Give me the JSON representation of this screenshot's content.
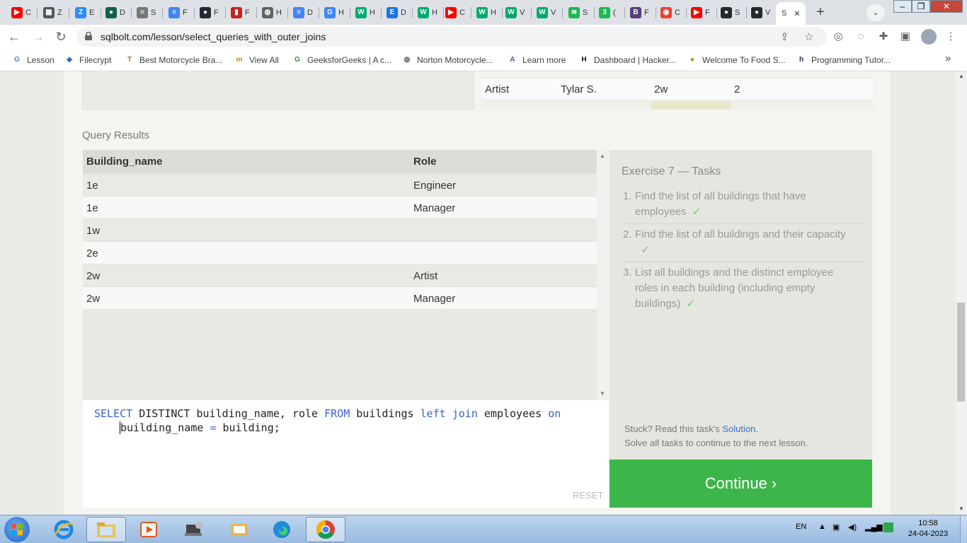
{
  "browser": {
    "tabs": [
      {
        "name": "tab-youtube-1",
        "letter": "C",
        "color": "#ff0000",
        "glyph": "▶"
      },
      {
        "name": "tab-2",
        "letter": "Z",
        "color": "#555555",
        "glyph": "▦"
      },
      {
        "name": "tab-zoom",
        "letter": "E",
        "color": "#2d8cff",
        "glyph": "Z"
      },
      {
        "name": "tab-mongodb",
        "letter": "D",
        "color": "#116149",
        "glyph": "●"
      },
      {
        "name": "tab-db",
        "letter": "S",
        "color": "#777777",
        "glyph": "≡"
      },
      {
        "name": "tab-docs-1",
        "letter": "F",
        "color": "#4285f4",
        "glyph": "≡"
      },
      {
        "name": "tab-github-1",
        "letter": "F",
        "color": "#24292e",
        "glyph": "●"
      },
      {
        "name": "tab-red",
        "letter": "F",
        "color": "#c5221f",
        "glyph": "▮"
      },
      {
        "name": "tab-globe",
        "letter": "H",
        "color": "#5f6368",
        "glyph": "◍"
      },
      {
        "name": "tab-docs-2",
        "letter": "D",
        "color": "#4285f4",
        "glyph": "≡"
      },
      {
        "name": "tab-google",
        "letter": "H",
        "color": "#4285f4",
        "glyph": "G"
      },
      {
        "name": "tab-w3-1",
        "letter": "H",
        "color": "#04aa6d",
        "glyph": "W"
      },
      {
        "name": "tab-ed",
        "letter": "D",
        "color": "#1a73e8",
        "glyph": "E"
      },
      {
        "name": "tab-w3-2",
        "letter": "H",
        "color": "#04aa6d",
        "glyph": "W"
      },
      {
        "name": "tab-youtube-2",
        "letter": "C",
        "color": "#ff0000",
        "glyph": "▶"
      },
      {
        "name": "tab-w3-3",
        "letter": "H",
        "color": "#04aa6d",
        "glyph": "W"
      },
      {
        "name": "tab-w3-4",
        "letter": "V",
        "color": "#04aa6d",
        "glyph": "W"
      },
      {
        "name": "tab-w3-5",
        "letter": "V",
        "color": "#04aa6d",
        "glyph": "W"
      },
      {
        "name": "tab-spotify",
        "letter": "S",
        "color": "#1db954",
        "glyph": "≋"
      },
      {
        "name": "tab-3",
        "letter": "(",
        "color": "#1db954",
        "glyph": "3"
      },
      {
        "name": "tab-bootstrap",
        "letter": "F",
        "color": "#563d7c",
        "glyph": "B"
      },
      {
        "name": "tab-maps",
        "letter": "C",
        "color": "#ea4335",
        "glyph": "◉"
      },
      {
        "name": "tab-youtube-3",
        "letter": "F",
        "color": "#ff0000",
        "glyph": "▶"
      },
      {
        "name": "tab-github-2",
        "letter": "S",
        "color": "#24292e",
        "glyph": "●"
      },
      {
        "name": "tab-github-3",
        "letter": "V",
        "color": "#24292e",
        "glyph": "●"
      }
    ],
    "active_tab_letter": "S",
    "close_glyph": "✕",
    "new_tab_glyph": "+",
    "tab_search_glyph": "⌄",
    "url": "sqlbolt.com/lesson/select_queries_with_outer_joins",
    "bookmarks": [
      {
        "label": "Lesson",
        "icon": "G",
        "color": "#4285f4"
      },
      {
        "label": "Filecrypt",
        "icon": "◆",
        "color": "#2b6ac9"
      },
      {
        "label": "Best Motorcycle Bra...",
        "icon": "T",
        "color": "#a8750e"
      },
      {
        "label": "View All",
        "icon": "m",
        "color": "#c8891a"
      },
      {
        "label": "GeeksforGeeks | A c...",
        "icon": "G",
        "color": "#2f8d46"
      },
      {
        "label": "Norton Motorcycle...",
        "icon": "◍",
        "color": "#5f6368"
      },
      {
        "label": "Learn more",
        "icon": "A",
        "color": "#6b3fd4"
      },
      {
        "label": "Dashboard | Hacker...",
        "icon": "H",
        "color": "#111111"
      },
      {
        "label": "Welcome To Food S...",
        "icon": "●",
        "color": "#d0762a"
      },
      {
        "label": "Programming Tutor...",
        "icon": "h",
        "color": "#2a2a5a"
      }
    ],
    "bookmarks_more": "»"
  },
  "previous_table": {
    "rows": [
      [
        "Artist",
        "Tylar S.",
        "2w",
        "2"
      ]
    ]
  },
  "results": {
    "title": "Query Results",
    "headers": [
      "Building_name",
      "Role"
    ],
    "rows": [
      [
        "1e",
        "Engineer"
      ],
      [
        "1e",
        "Manager"
      ],
      [
        "1w",
        ""
      ],
      [
        "2e",
        ""
      ],
      [
        "2w",
        "Artist"
      ],
      [
        "2w",
        "Manager"
      ]
    ]
  },
  "editor": {
    "reset_label": "RESET"
  },
  "tasks": {
    "title": "Exercise 7 — Tasks",
    "items": [
      {
        "num": "1.",
        "line1": "Find the list of all buildings that have",
        "line2": "employees",
        "check": "✓"
      },
      {
        "num": "2.",
        "line1": "Find the list of all buildings and their capacity",
        "line2": "",
        "check": "✓"
      },
      {
        "num": "3.",
        "line1": "List all buildings and the distinct employee",
        "line2": "roles in each building (including empty",
        "line3": "buildings)",
        "check": "✓"
      }
    ],
    "stuck_prefix": "Stuck? Read this task's",
    "solution_link": "Solution",
    "stuck_suffix": ".",
    "continue_hint": "Solve all tasks to continue to the next lesson.",
    "continue_label": "Continue ›"
  },
  "taskbar": {
    "language": "EN",
    "time": "10:58",
    "date": "24-04-2023"
  }
}
